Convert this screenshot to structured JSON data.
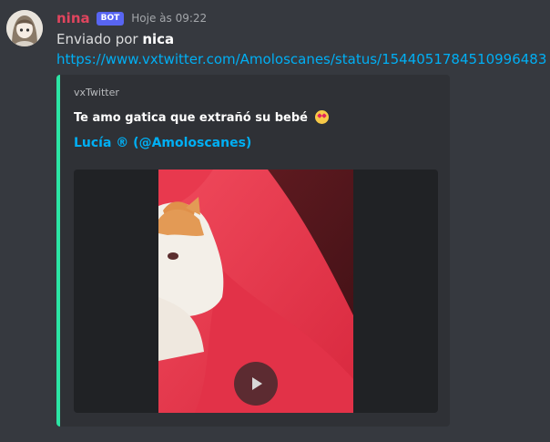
{
  "message": {
    "username": "nina",
    "bot_tag": "BOT",
    "timestamp": "Hoje às 09:22",
    "sent_by_prefix": "Enviado por",
    "sent_by_user": "nica",
    "link": "https://www.vxtwitter.com/Amoloscanes/status/1544051784510996483"
  },
  "embed": {
    "provider": "vxTwitter",
    "description": "Te amo gatica que extrañó su bebé",
    "description_emoji": "smiling-face-with-heart-eyes-icon",
    "author": "Lucía ® (@Amoloscanes)",
    "accent_color": "#2ce5a4",
    "video": {
      "play_icon": "play-icon"
    }
  },
  "colors": {
    "background": "#36393f",
    "embed_bg": "#2f3136",
    "username": "#e0455e",
    "link": "#00aff4",
    "bot_tag": "#5865f2"
  }
}
